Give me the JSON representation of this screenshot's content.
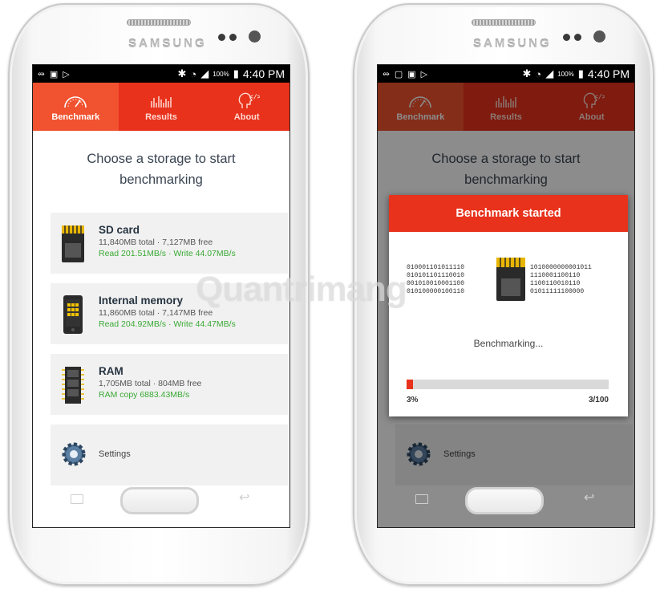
{
  "device": {
    "brand": "SAMSUNG"
  },
  "status_bar": {
    "battery": "100%",
    "time": "4:40 PM"
  },
  "tabs": [
    {
      "label": "Benchmark",
      "icon": "speedometer-icon",
      "active": true
    },
    {
      "label": "Results",
      "icon": "bar-chart-icon",
      "active": false
    },
    {
      "label": "About",
      "icon": "head-code-icon",
      "active": false
    }
  ],
  "heading": "Choose a storage to start benchmarking",
  "storages": [
    {
      "title": "SD card",
      "details": "11,840MB total · 7,127MB free",
      "speed": "Read 201.51MB/s · Write 44.07MB/s",
      "icon": "sd-card-icon"
    },
    {
      "title": "Internal memory",
      "details": "11,860MB total · 7,147MB free",
      "speed": "Read 204.92MB/s · Write 44.47MB/s",
      "icon": "phone-chip-icon"
    },
    {
      "title": "RAM",
      "details": "1,705MB total · 804MB free",
      "speed": "RAM copy 6883.43MB/s",
      "icon": "ram-chip-icon"
    }
  ],
  "settings": {
    "label": "Settings",
    "icon": "gear-icon"
  },
  "dialog": {
    "title": "Benchmark started",
    "binary_left": [
      "010001101011110",
      "010101101110010",
      "001010010001100",
      "010100000100110"
    ],
    "binary_right": [
      "1010000000001011",
      "1110001100110",
      "1100110010110",
      "01011111100000"
    ],
    "status": "Benchmarking...",
    "progress": 0.03,
    "progress_text": "3%",
    "count_text": "3/100"
  },
  "watermark": "Quantrimang",
  "colors": {
    "accent": "#e8321c",
    "accent_active": "#f1522f",
    "speed_green": "#3aaa35"
  }
}
